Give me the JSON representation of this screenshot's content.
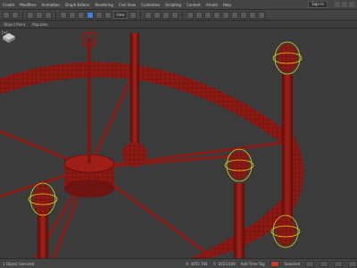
{
  "menu": {
    "items": [
      {
        "label": "Create"
      },
      {
        "label": "Modifiers"
      },
      {
        "label": "Animation"
      },
      {
        "label": "Graph Editors"
      },
      {
        "label": "Rendering"
      },
      {
        "label": "Civil View"
      },
      {
        "label": "Customize"
      },
      {
        "label": "Scripting"
      },
      {
        "label": "Content"
      },
      {
        "label": "Arnold"
      },
      {
        "label": "Help"
      }
    ],
    "sign_in": "Sign In"
  },
  "toolbar": {
    "view_dropdown": "View"
  },
  "ribbon": {
    "items": [
      {
        "label": "Object Paint"
      },
      {
        "label": "Populate"
      }
    ]
  },
  "viewport": {
    "label": "[+]",
    "model_color": "#8b1a14",
    "selection_color": "#e0d21a"
  },
  "statusbar": {
    "left_text": "1 Object Selected",
    "coord_x": "X: 4055.764",
    "coord_y": "Y: -2023.649",
    "key_label": "Add Time Tag",
    "auto_label": "Selected"
  }
}
